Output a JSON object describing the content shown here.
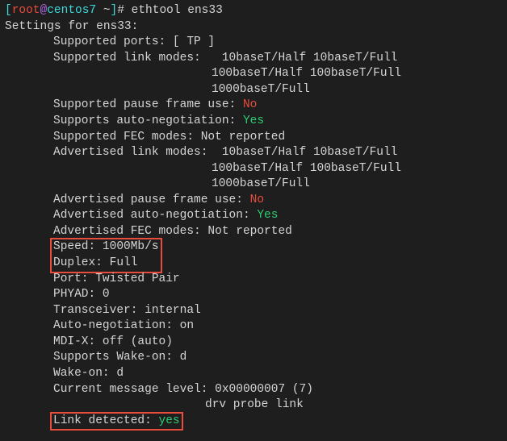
{
  "prompt": {
    "bracket_open": "[",
    "user": "root",
    "at": "@",
    "host": "centos7",
    "path": " ~",
    "bracket_close": "]",
    "hash": "# ",
    "command": "ethtool ens33"
  },
  "header": "Settings for ens33:",
  "lines": {
    "supported_ports": "Supported ports: [ TP ]",
    "supported_link_modes_label": "Supported link modes:   ",
    "supported_link_modes_1": "10baseT/Half 10baseT/Full",
    "supported_link_modes_2": "100baseT/Half 100baseT/Full",
    "supported_link_modes_3": "1000baseT/Full",
    "supported_pause_label": "Supported pause frame use: ",
    "supported_pause_value": "No",
    "supports_autoneg_label": "Supports auto-negotiation: ",
    "supports_autoneg_value": "Yes",
    "supported_fec": "Supported FEC modes: Not reported",
    "advertised_link_modes_label": "Advertised link modes:  ",
    "advertised_link_modes_1": "10baseT/Half 10baseT/Full",
    "advertised_link_modes_2": "100baseT/Half 100baseT/Full",
    "advertised_link_modes_3": "1000baseT/Full",
    "advertised_pause_label": "Advertised pause frame use: ",
    "advertised_pause_value": "No",
    "advertised_autoneg_label": "Advertised auto-negotiation: ",
    "advertised_autoneg_value": "Yes",
    "advertised_fec": "Advertised FEC modes: Not reported",
    "speed": "Speed: 1000Mb/s",
    "duplex": "Duplex: Full",
    "port": "Port: Twisted Pair",
    "phyad": "PHYAD: 0",
    "transceiver": "Transceiver: internal",
    "autoneg": "Auto-negotiation: on",
    "mdix": "MDI-X: off (auto)",
    "supports_wakeon": "Supports Wake-on: d",
    "wakeon": "Wake-on: d",
    "msg_level": "Current message level: 0x00000007 (7)",
    "msg_level_2": "drv probe link",
    "link_detected_label": "Link detected: ",
    "link_detected_value": "yes"
  }
}
